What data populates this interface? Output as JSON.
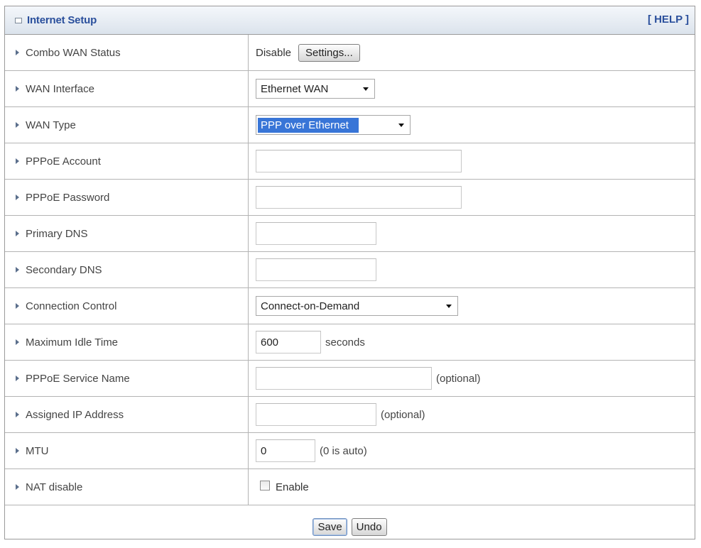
{
  "header": {
    "title": "Internet Setup",
    "help": "[ HELP ]"
  },
  "rows": {
    "combo_wan": {
      "label": "Combo WAN Status",
      "value": "Disable",
      "button": "Settings..."
    },
    "wan_interface": {
      "label": "WAN Interface",
      "selected": "Ethernet WAN"
    },
    "wan_type": {
      "label": "WAN Type",
      "selected": "PPP over Ethernet"
    },
    "pppoe_account": {
      "label": "PPPoE Account",
      "value": ""
    },
    "pppoe_password": {
      "label": "PPPoE Password",
      "value": ""
    },
    "primary_dns": {
      "label": "Primary DNS",
      "value": ""
    },
    "secondary_dns": {
      "label": "Secondary DNS",
      "value": ""
    },
    "connection_control": {
      "label": "Connection Control",
      "selected": "Connect-on-Demand"
    },
    "max_idle_time": {
      "label": "Maximum Idle Time",
      "value": "600",
      "unit": "seconds"
    },
    "service_name": {
      "label": "PPPoE Service Name",
      "value": "",
      "note": "(optional)"
    },
    "assigned_ip": {
      "label": "Assigned IP Address",
      "value": "",
      "note": "(optional)"
    },
    "mtu": {
      "label": "MTU",
      "value": "0",
      "note": "(0 is auto)"
    },
    "nat_disable": {
      "label": "NAT disable",
      "checkbox_label": "Enable",
      "checked": false
    }
  },
  "footer": {
    "save": "Save",
    "undo": "Undo"
  },
  "colors": {
    "header_text": "#2a4f9c",
    "selection": "#3875d7",
    "arrow": "#5b6f8c"
  }
}
